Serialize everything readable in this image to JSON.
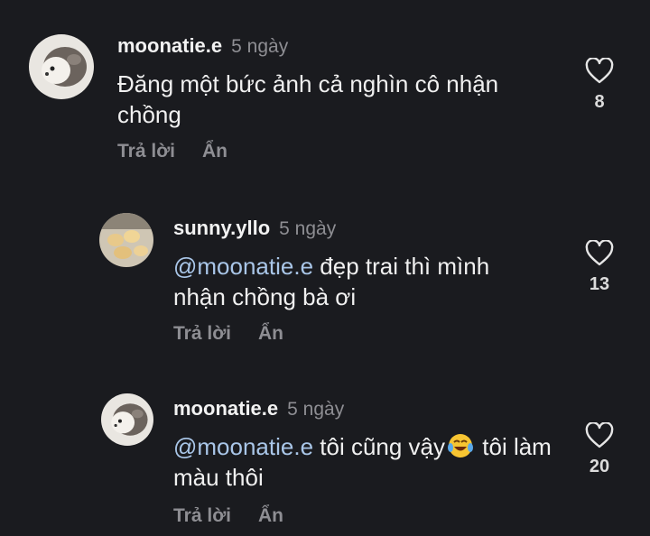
{
  "comments": [
    {
      "username": "moonatie.e",
      "time": "5 ngày",
      "mention": "",
      "text": "Đăng một bức ảnh cả nghìn cô nhận chồng",
      "text_after_emoji": "",
      "reply_label": "Trả lời",
      "hide_label": "Ẩn",
      "likes": "8",
      "avatar_icon": "hedgehog-avatar-icon"
    },
    {
      "username": "sunny.yllo",
      "time": "5 ngày",
      "mention": "@moonatie.e",
      "text": " đẹp trai thì mình nhận chồng bà ơi",
      "text_after_emoji": "",
      "reply_label": "Trả lời",
      "hide_label": "Ẩn",
      "likes": "13",
      "avatar_icon": "bread-avatar-icon"
    },
    {
      "username": "moonatie.e",
      "time": "5 ngày",
      "mention": "@moonatie.e",
      "text": " tôi cũng vậy",
      "text_after_emoji": " tôi làm màu thôi",
      "reply_label": "Trả lời",
      "hide_label": "Ẩn",
      "likes": "20",
      "avatar_icon": "hedgehog-avatar-icon"
    }
  ],
  "colors": {
    "background": "#1a1b1f",
    "mention": "#a9c6e8",
    "muted": "#8e8e93"
  }
}
